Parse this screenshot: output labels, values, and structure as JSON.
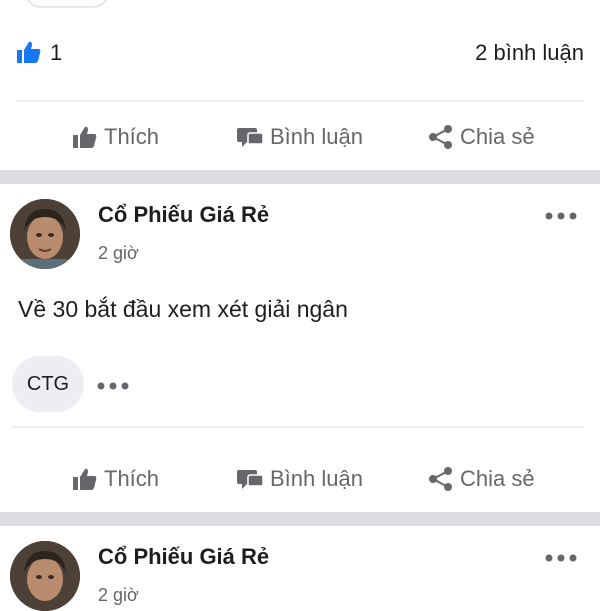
{
  "summary": {
    "like_count": "1",
    "comment_count": "2 bình luận"
  },
  "actions": {
    "like": "Thích",
    "comment": "Bình luận",
    "share": "Chia sẻ"
  },
  "posts": [
    {
      "author": "Cổ Phiếu Giá Rẻ",
      "time": "2 giờ",
      "text": "Về 30 bắt đầu xem xét giải ngân",
      "tag": "CTG"
    },
    {
      "author": "Cổ Phiếu Giá Rẻ",
      "time": "2 giờ"
    }
  ],
  "icons": {
    "like": "thumbs-up-icon",
    "comment": "comment-icon",
    "share": "share-icon",
    "more": "more-icon"
  },
  "colors": {
    "facebook_blue": "#1877f2",
    "secondary_text": "#65676b",
    "separator": "#dcdde1"
  }
}
